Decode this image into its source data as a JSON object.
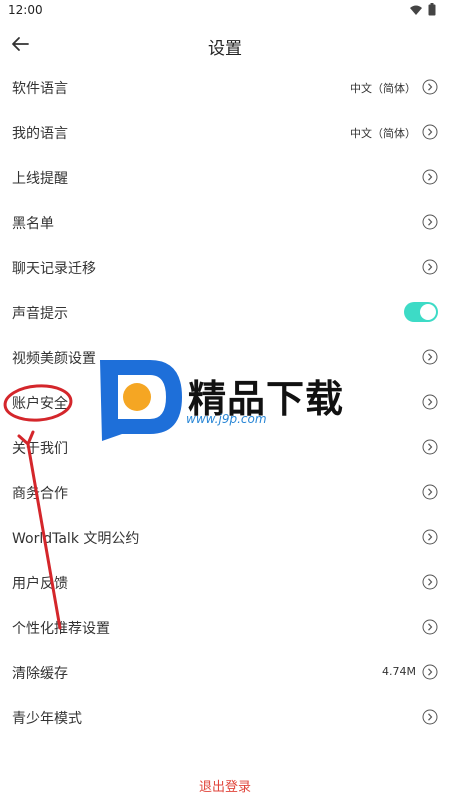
{
  "status_bar": {
    "time": "12:00",
    "icons": [
      "wifi-icon",
      "battery-icon"
    ]
  },
  "header": {
    "title": "设置",
    "back_icon": "arrow-left-icon"
  },
  "settings": {
    "items": [
      {
        "label": "软件语言",
        "value": "中文（简体）"
      },
      {
        "label": "我的语言",
        "value": "中文（简体）"
      },
      {
        "label": "上线提醒"
      },
      {
        "label": "黑名单"
      },
      {
        "label": "聊天记录迁移"
      },
      {
        "label": "声音提示",
        "toggle_on": true
      },
      {
        "label": "视频美颜设置"
      },
      {
        "label": "账户安全"
      },
      {
        "label": "关于我们"
      },
      {
        "label": "商务合作"
      },
      {
        "label": "WorldTalk 文明公约"
      },
      {
        "label": "用户反馈"
      },
      {
        "label": "个性化推荐设置"
      },
      {
        "label": "清除缓存",
        "value": "4.74M"
      },
      {
        "label": "青少年模式"
      }
    ]
  },
  "logout": {
    "label": "退出登录"
  },
  "watermark": {
    "brand": "精品下载",
    "url": "www.j9p.com"
  },
  "colors": {
    "accent": "#3ddbc6",
    "logout": "#e0463c",
    "annotation": "#d4262b"
  }
}
